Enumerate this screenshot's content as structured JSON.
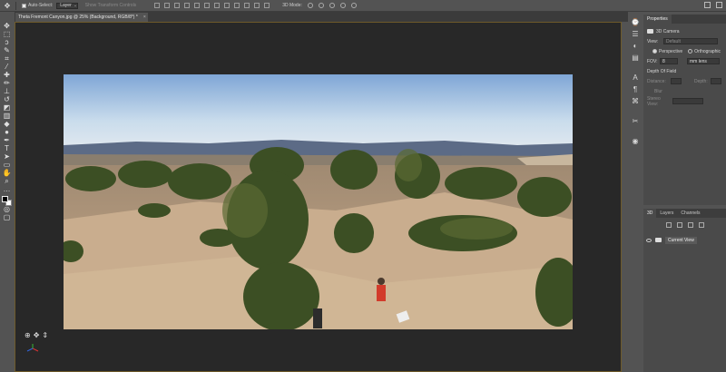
{
  "options_bar": {
    "auto_select_label": "Auto-Select:",
    "auto_select_value": "Layer",
    "show_transform_label": "Show Transform Controls",
    "mode_3d_label": "3D Mode:"
  },
  "document_tab": {
    "title": "Theta Fremont Canyon.jpg @ 25% (Background, RGB/8*) *",
    "close": "×"
  },
  "properties_panel": {
    "tab": "Properties",
    "section_title": "3D Camera",
    "view_label": "View:",
    "view_value": "Default",
    "perspective_label": "Perspective",
    "orthographic_label": "Orthographic",
    "fov_label": "FOV:",
    "fov_value": "8",
    "fov_unit": "mm lens",
    "depth_of_field_label": "Depth Of Field",
    "distance_label": "Distance:",
    "depth_label": "Depth:",
    "blur_label": "Blur",
    "stereo_view_label": "Stereo View:"
  },
  "layers_panel": {
    "tabs": [
      "3D",
      "Layers",
      "Channels"
    ],
    "active_tab": "3D",
    "layer_name": "Current View"
  },
  "colors": {
    "accent_border": "#6e5a2a",
    "foreground": "#000000",
    "background": "#ffffff"
  },
  "icons": {
    "move_tool": "move-icon",
    "marquee": "marquee-icon",
    "lasso": "lasso-icon",
    "crop": "crop-icon",
    "eyedropper": "eyedropper-icon",
    "brush": "brush-icon",
    "type": "type-icon",
    "hand": "hand-icon",
    "zoom": "zoom-icon"
  }
}
